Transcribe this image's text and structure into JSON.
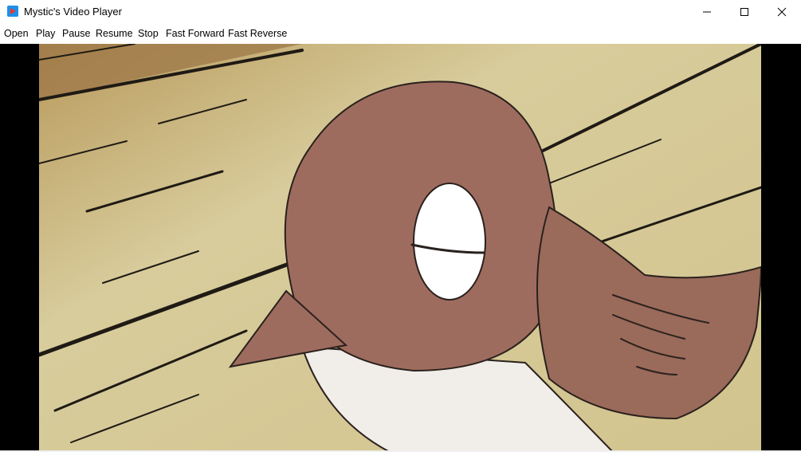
{
  "window": {
    "title": "Mystic's Video Player",
    "icon": "media-player-icon"
  },
  "controls": {
    "minimize_icon": "minimize-icon",
    "maximize_icon": "maximize-icon",
    "close_icon": "close-icon"
  },
  "menu": {
    "open": "Open",
    "play": "Play",
    "pause": "Pause",
    "resume": "Resume",
    "stop": "Stop",
    "fast_forward": "Fast Forward",
    "fast_reverse": "Fast Reverse"
  },
  "video": {
    "content": "animated-sparrow-frame",
    "colors": {
      "background": "#d6c99a",
      "bird_body": "#9e6c5e",
      "bird_belly": "#f1eeea",
      "outline": "#2a211d",
      "letterbox": "#000000"
    }
  }
}
